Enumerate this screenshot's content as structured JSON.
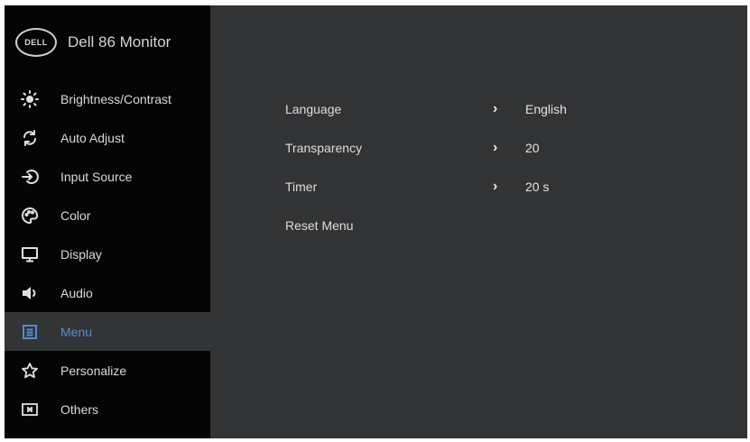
{
  "header": {
    "logo_text": "DELL",
    "title": "Dell 86 Monitor"
  },
  "sidebar": {
    "items": [
      {
        "label": "Brightness/Contrast",
        "icon": "brightness-icon"
      },
      {
        "label": "Auto Adjust",
        "icon": "auto-adjust-icon"
      },
      {
        "label": "Input Source",
        "icon": "input-source-icon"
      },
      {
        "label": "Color",
        "icon": "color-palette-icon"
      },
      {
        "label": "Display",
        "icon": "display-monitor-icon"
      },
      {
        "label": "Audio",
        "icon": "speaker-icon"
      },
      {
        "label": "Menu",
        "icon": "menu-icon",
        "active": true
      },
      {
        "label": "Personalize",
        "icon": "star-icon"
      },
      {
        "label": "Others",
        "icon": "others-icon"
      }
    ]
  },
  "menu_settings": {
    "rows": [
      {
        "label": "Language",
        "value": "English"
      },
      {
        "label": "Transparency",
        "value": "20"
      },
      {
        "label": "Timer",
        "value": "20 s"
      },
      {
        "label": "Reset Menu",
        "value": ""
      }
    ]
  },
  "colors": {
    "sidebar_bg": "#050505",
    "content_bg": "#323335",
    "active_bg": "#333436",
    "accent": "#4f8ed1"
  }
}
